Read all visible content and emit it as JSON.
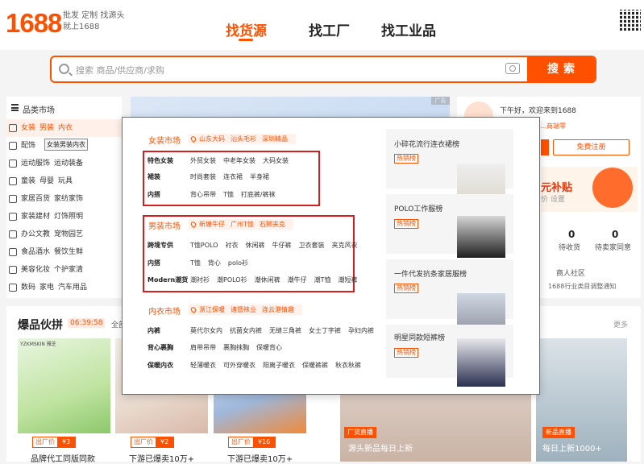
{
  "header": {
    "logo": "1688",
    "slogan_line1": "批发 定制 找源头",
    "slogan_line2": "就上1688",
    "tabs": [
      {
        "label": "找货源",
        "active": true
      },
      {
        "label": "找工厂",
        "active": false
      },
      {
        "label": "找工业品",
        "active": false
      }
    ]
  },
  "search": {
    "placeholder": "搜索 商品/供应商/求购",
    "button": "搜索"
  },
  "categories": {
    "title": "品类市场",
    "rows": [
      {
        "items": [
          "女装",
          "男装",
          "内衣"
        ],
        "active": true,
        "icon": "shirt-icon"
      },
      {
        "items": [
          "配饰",
          "鞋靴",
          "箱包"
        ],
        "active": false,
        "icon": "shoe-icon"
      },
      {
        "items": [
          "运动服饰",
          "运动装备"
        ],
        "active": false,
        "icon": "sport-icon"
      },
      {
        "items": [
          "童装",
          "母婴",
          "玩具"
        ],
        "active": false,
        "icon": "baby-icon"
      },
      {
        "items": [
          "家居百货",
          "家纺家饰"
        ],
        "active": false,
        "icon": "home-icon"
      },
      {
        "items": [
          "家装建材",
          "灯饰照明"
        ],
        "active": false,
        "icon": "lamp-icon"
      },
      {
        "items": [
          "办公文教",
          "宠物园艺"
        ],
        "active": false,
        "icon": "pen-icon"
      },
      {
        "items": [
          "食品酒水",
          "餐饮生鲜"
        ],
        "active": false,
        "icon": "food-icon"
      },
      {
        "items": [
          "美容化妆",
          "个护家清"
        ],
        "active": false,
        "icon": "beauty-icon"
      },
      {
        "items": [
          "数码",
          "家电",
          "汽车用品"
        ],
        "active": false,
        "icon": "camera-icon"
      }
    ],
    "tooltip": "女装男装内衣"
  },
  "banner": {
    "corner_label": "广告"
  },
  "user": {
    "greeting": "下午好，欢迎来到1688",
    "sub_greeting": "…商端零",
    "register": "免费注册",
    "promo_title": "元补贴",
    "promo_sub": "价 设置",
    "stats": [
      {
        "value": "0",
        "label": "待收货"
      },
      {
        "value": "0",
        "label": "待卖家同意"
      }
    ],
    "community": "商人社区",
    "notice": "1688行业类目调整通知"
  },
  "popup": {
    "sections": [
      {
        "title": "女装市场",
        "tags": [
          "山东大码",
          "汕头毛衫",
          "深圳精品"
        ],
        "rows": [
          {
            "label": "特色女装",
            "items": [
              "外贸女装",
              "中老年女装",
              "大码女装"
            ]
          },
          {
            "label": "裙装",
            "items": [
              "时尚套装",
              "连衣裙",
              "半身裙"
            ]
          },
          {
            "label": "内搭",
            "items": [
              "背心吊带",
              "T恤",
              "打底裤/裤袜"
            ]
          }
        ]
      },
      {
        "title": "男装市场",
        "tags": [
          "新塘牛仔",
          "广州T恤",
          "石狮夹克"
        ],
        "rows": [
          {
            "label": "跨境专供",
            "items": [
              "T恤POLO",
              "衬衣",
              "休闲裤",
              "牛仔裤",
              "卫衣套装",
              "夹克风衣"
            ]
          },
          {
            "label": "内搭",
            "items": [
              "T恤",
              "背心",
              "polo衫"
            ]
          },
          {
            "label": "Modern潮货",
            "items": [
              "潮衬衫",
              "潮POLO衫",
              "潮休闲裤",
              "潮牛仔",
              "潮T恤",
              "潮短裤"
            ]
          }
        ]
      },
      {
        "title": "内衣市场",
        "tags": [
          "浙江保暖",
          "诸暨袜业",
          "连云港情趣"
        ],
        "rows": [
          {
            "label": "内裤",
            "items": [
              "莫代尔女内",
              "抗菌女内裤",
              "无缝三角裤",
              "女士丁字裤",
              "孕妇内裤"
            ]
          },
          {
            "label": "背心裹胸",
            "items": [
              "肩带吊带",
              "裹胸抹胸",
              "保暖背心"
            ]
          },
          {
            "label": "保暖内衣",
            "items": [
              "轻薄暖衣",
              "可外穿暖衣",
              "阳离子暖衣",
              "保暖裤裤",
              "秋衣秋裤"
            ]
          }
        ]
      }
    ],
    "side_cards": [
      {
        "title": "小碎花流行连衣裙榜",
        "badge": "热销榜"
      },
      {
        "title": "POLO工作服榜",
        "badge": "热销榜"
      },
      {
        "title": "一件代发抗条家居服榜",
        "badge": "热销榜"
      },
      {
        "title": "明星同款短裤榜",
        "badge": "热销榜"
      }
    ]
  },
  "hot_section": {
    "title": "爆品伙拼",
    "timer": "06:39:58",
    "all": "全部",
    "more": "更多",
    "products": [
      {
        "brand": "YZKMSKIN 雅芝",
        "price_label": "出厂价",
        "price": "¥3",
        "caption": "品牌代工同版同款"
      },
      {
        "price_label": "出厂价",
        "price": "¥2",
        "caption": "下游已爆卖10万+"
      },
      {
        "price_label": "出厂价",
        "price": "¥16",
        "caption": "下游已爆卖10万+"
      }
    ],
    "live": [
      {
        "badge": "厂货直播",
        "caption": "源头新品每日上新"
      },
      {
        "badge": "新品直播",
        "caption": "每日上新1000+"
      }
    ]
  }
}
